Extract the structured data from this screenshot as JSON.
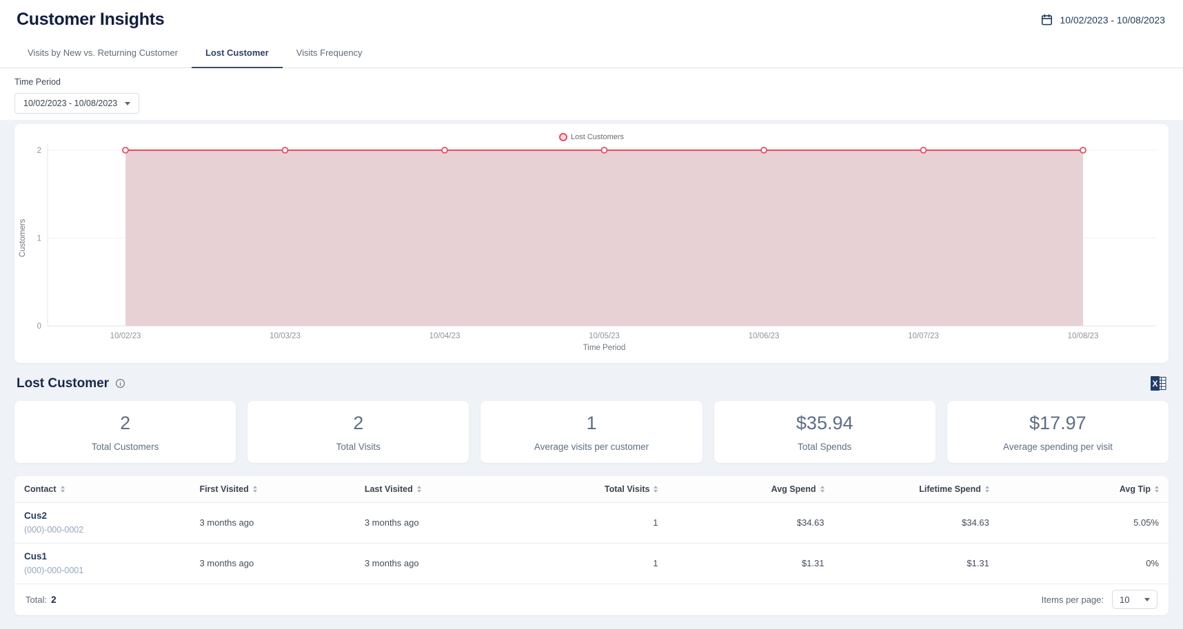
{
  "header": {
    "title": "Customer Insights",
    "date_range": "10/02/2023 - 10/08/2023"
  },
  "tabs": [
    {
      "label": "Visits by New vs. Returning Customer",
      "active": false
    },
    {
      "label": "Lost Customer",
      "active": true
    },
    {
      "label": "Visits Frequency",
      "active": false
    }
  ],
  "filter": {
    "label": "Time Period",
    "value": "10/02/2023 - 10/08/2023"
  },
  "chart_data": {
    "type": "area",
    "x": [
      "10/02/23",
      "10/03/23",
      "10/04/23",
      "10/05/23",
      "10/06/23",
      "10/07/23",
      "10/08/23"
    ],
    "series": [
      {
        "name": "Lost Customers",
        "values": [
          2,
          2,
          2,
          2,
          2,
          2,
          2
        ]
      }
    ],
    "xlabel": "Time Period",
    "ylabel": "Customers",
    "ylim": [
      0,
      2
    ],
    "yticks": [
      0,
      1,
      2
    ],
    "grid": true,
    "legend_position": "top-center",
    "line_color": "#f0495d",
    "fill_color": "#e8d1d5",
    "marker_fill": "#ffffff"
  },
  "section": {
    "title": "Lost Customer"
  },
  "stats": [
    {
      "value": "2",
      "label": "Total Customers"
    },
    {
      "value": "2",
      "label": "Total Visits"
    },
    {
      "value": "1",
      "label": "Average visits per customer"
    },
    {
      "value": "$35.94",
      "label": "Total Spends"
    },
    {
      "value": "$17.97",
      "label": "Average spending per visit"
    }
  ],
  "table": {
    "columns": [
      {
        "key": "contact",
        "label": "Contact",
        "align": "left",
        "width": "15.2%"
      },
      {
        "key": "first_visited",
        "label": "First Visited",
        "align": "left",
        "width": "14.3%"
      },
      {
        "key": "last_visited",
        "label": "Last Visited",
        "align": "left",
        "width": "16.5%"
      },
      {
        "key": "total_visits",
        "label": "Total Visits",
        "align": "right",
        "width": "10.6%"
      },
      {
        "key": "avg_spend",
        "label": "Avg Spend",
        "align": "right",
        "width": "14.4%"
      },
      {
        "key": "lifetime_spend",
        "label": "Lifetime Spend",
        "align": "right",
        "width": "14.3%"
      },
      {
        "key": "avg_tip",
        "label": "Avg Tip",
        "align": "right",
        "width": "14.7%"
      }
    ],
    "rows": [
      {
        "contact_name": "Cus2",
        "contact_phone": "(000)-000-0002",
        "first_visited": "3 months ago",
        "last_visited": "3 months ago",
        "total_visits": "1",
        "avg_spend": "$34.63",
        "lifetime_spend": "$34.63",
        "avg_tip": "5.05%"
      },
      {
        "contact_name": "Cus1",
        "contact_phone": "(000)-000-0001",
        "first_visited": "3 months ago",
        "last_visited": "3 months ago",
        "total_visits": "1",
        "avg_spend": "$1.31",
        "lifetime_spend": "$1.31",
        "avg_tip": "0%"
      }
    ]
  },
  "table_footer": {
    "total_label": "Total:",
    "total_value": "2",
    "items_per_page_label": "Items per page:",
    "items_per_page_value": "10"
  }
}
